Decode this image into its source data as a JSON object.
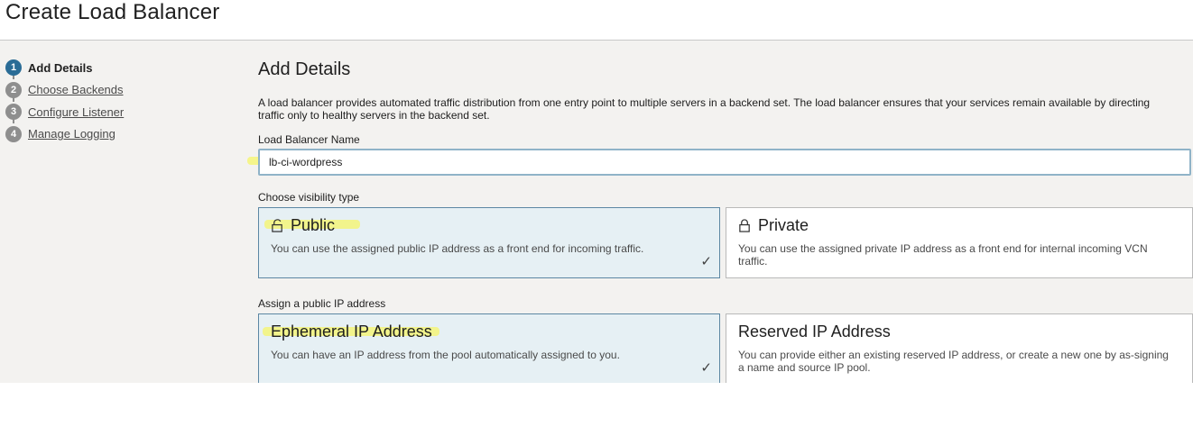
{
  "page": {
    "title": "Create Load Balancer"
  },
  "steps": [
    {
      "num": "1",
      "label": "Add Details"
    },
    {
      "num": "2",
      "label": "Choose Backends"
    },
    {
      "num": "3",
      "label": "Configure Listener"
    },
    {
      "num": "4",
      "label": "Manage Logging"
    }
  ],
  "section": {
    "title": "Add Details",
    "intro": "A load balancer provides automated traffic distribution from one entry point to multiple servers in a backend set. The load balancer ensures that your services remain available by directing traffic only to healthy servers in the backend set."
  },
  "name_field": {
    "label": "Load Balancer Name",
    "value": "lb-ci-wordpress"
  },
  "visibility": {
    "label": "Choose visibility type",
    "selected": "Public",
    "options": [
      {
        "title": "Public",
        "desc": "You can use the assigned public IP address as a front end for incoming traffic."
      },
      {
        "title": "Private",
        "desc": "You can use the assigned private IP address as a front end for internal incoming VCN traffic."
      }
    ]
  },
  "ip": {
    "label": "Assign a public IP address",
    "selected": "Ephemeral IP Address",
    "options": [
      {
        "title": "Ephemeral IP Address",
        "desc": "You can have an IP address from the pool automatically assigned to you."
      },
      {
        "title": "Reserved IP Address",
        "desc": "You can provide either an existing reserved IP address, or create a new one by as-signing a name and source IP pool."
      }
    ]
  },
  "icons": {
    "lock": "lock-icon",
    "check": "check-icon"
  },
  "colors": {
    "accent": "#2a6c96",
    "selected_bg": "#e6f0f4",
    "highlight": "#f5f56a"
  }
}
